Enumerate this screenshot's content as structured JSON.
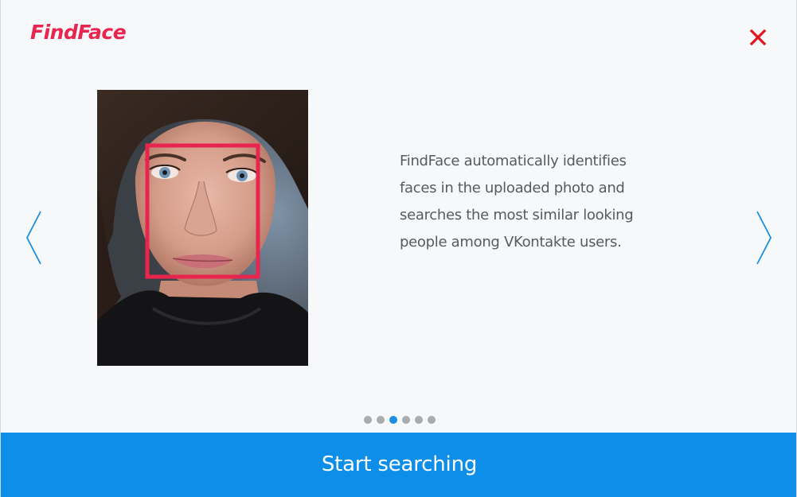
{
  "app": {
    "logo_text": "FindFace"
  },
  "header": {
    "close_icon": "close-icon",
    "close_color": "#e0141f"
  },
  "slide": {
    "photo_subject": "woman-face-photo",
    "face_box_color": "#e8254e",
    "description": "FindFace automatically identifies faces in the uploaded photo and searches the most similar looking people among VKontakte users."
  },
  "navigation": {
    "prev_icon": "chevron-left-icon",
    "next_icon": "chevron-right-icon",
    "arrow_color": "#1a8fe3"
  },
  "pagination": {
    "total": 6,
    "active_index": 2,
    "active_color": "#1a8fe3",
    "inactive_color": "#a9abad"
  },
  "footer": {
    "start_label": "Start searching",
    "button_color": "#0d8ee9"
  }
}
